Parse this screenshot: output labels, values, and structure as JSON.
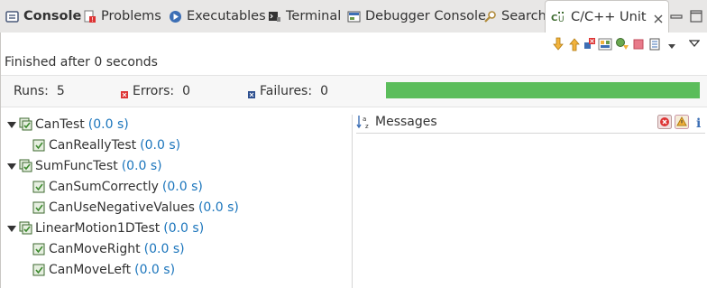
{
  "tabs": [
    {
      "label": "Console",
      "icon": "console-icon"
    },
    {
      "label": "Problems",
      "icon": "problems-icon"
    },
    {
      "label": "Executables",
      "icon": "executables-icon"
    },
    {
      "label": "Terminal",
      "icon": "terminal-icon"
    },
    {
      "label": "Debugger Console",
      "icon": "debugger-console-icon"
    },
    {
      "label": "Search",
      "icon": "search-icon"
    },
    {
      "label": "C/C++ Unit",
      "icon": "cpp-unit-icon",
      "active": true
    }
  ],
  "status": {
    "finished": "Finished after 0 seconds"
  },
  "counters": {
    "runs_label": "Runs:",
    "runs_value": "5",
    "errors_label": "Errors:",
    "errors_value": "0",
    "failures_label": "Failures:",
    "failures_value": "0",
    "progress_fraction": 1.0,
    "progress_color": "#5bbd5b"
  },
  "tree": [
    {
      "name": "CanTest",
      "time": "(0.0 s)",
      "children": [
        {
          "name": "CanReallyTest",
          "time": "(0.0 s)"
        }
      ]
    },
    {
      "name": "SumFuncTest",
      "time": "(0.0 s)",
      "children": [
        {
          "name": "CanSumCorrectly",
          "time": "(0.0 s)"
        },
        {
          "name": "CanUseNegativeValues",
          "time": "(0.0 s)"
        }
      ]
    },
    {
      "name": "LinearMotion1DTest",
      "time": "(0.0 s)",
      "children": [
        {
          "name": "CanMoveRight",
          "time": "(0.0 s)"
        },
        {
          "name": "CanMoveLeft",
          "time": "(0.0 s)"
        }
      ]
    }
  ],
  "messages": {
    "title": "Messages"
  },
  "colors": {
    "time_text": "#1b75bc",
    "success": "#5bbd5b"
  }
}
